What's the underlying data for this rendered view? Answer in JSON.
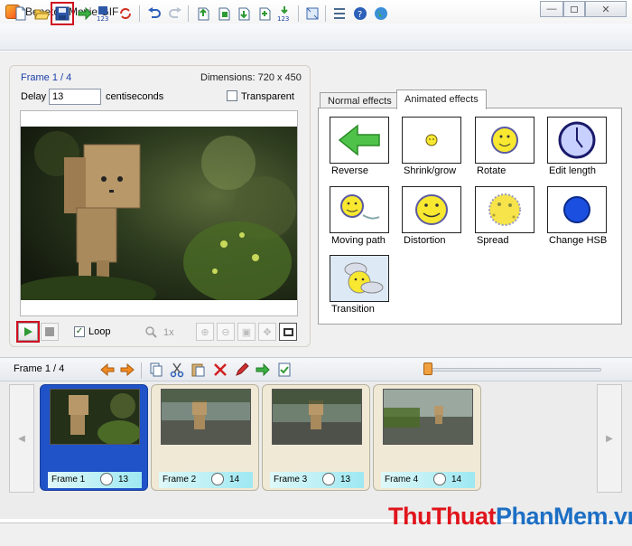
{
  "window": {
    "title": "Beneton Movie GIF",
    "minimize_label": "—",
    "close_label": "✕"
  },
  "toolbar": {
    "buttons": [
      "new-icon",
      "open-icon",
      "save-icon",
      "export-icon",
      "save-frames-icon",
      "convert-icon",
      "undo-icon",
      "redo-icon",
      "insert-frame-icon",
      "add-frame-icon",
      "import-icon",
      "import-frames-icon",
      "numbered-import-icon",
      "resize-icon",
      "properties-icon",
      "help-icon",
      "web-icon"
    ],
    "frames_badge": "123"
  },
  "frame_panel": {
    "frame_label": "Frame 1 / 4",
    "dimensions": "Dimensions: 720 x 450",
    "delay_label": "Delay",
    "delay_value": "13",
    "delay_unit": "centiseconds",
    "transparent_label": "Transparent",
    "transparent_checked": false,
    "loop_label": "Loop",
    "loop_checked": true,
    "zoom_level": "1x"
  },
  "effects": {
    "tabs": [
      {
        "label": "Normal effects",
        "active": false
      },
      {
        "label": "Animated effects",
        "active": true
      }
    ],
    "items": [
      {
        "label": "Reverse",
        "icon": "reverse-arrow-icon"
      },
      {
        "label": "Shrink/grow",
        "icon": "shrink-grow-icon"
      },
      {
        "label": "Rotate",
        "icon": "rotate-icon"
      },
      {
        "label": "Edit length",
        "icon": "edit-length-icon"
      },
      {
        "label": "Moving path",
        "icon": "moving-path-icon"
      },
      {
        "label": "Distortion",
        "icon": "distortion-icon"
      },
      {
        "label": "Spread",
        "icon": "spread-icon"
      },
      {
        "label": "Change HSB",
        "icon": "change-hsb-icon"
      },
      {
        "label": "Transition",
        "icon": "transition-icon"
      }
    ]
  },
  "frames_bar": {
    "label": "Frame 1 / 4",
    "slider_position": 0
  },
  "frames": [
    {
      "name": "Frame 1",
      "delay": "13",
      "selected": true
    },
    {
      "name": "Frame 2",
      "delay": "14",
      "selected": false
    },
    {
      "name": "Frame 3",
      "delay": "13",
      "selected": false
    },
    {
      "name": "Frame 4",
      "delay": "14",
      "selected": false
    }
  ],
  "watermark": {
    "part1": "ThuThuat",
    "part2": "PhanMem",
    "part3": ".vn",
    "color1": "#e0151c",
    "color2": "#1d6fc4"
  },
  "colors": {
    "highlight": "#d01020",
    "selected_frame": "#2052c8",
    "frame_label": "#1a3fa8"
  }
}
